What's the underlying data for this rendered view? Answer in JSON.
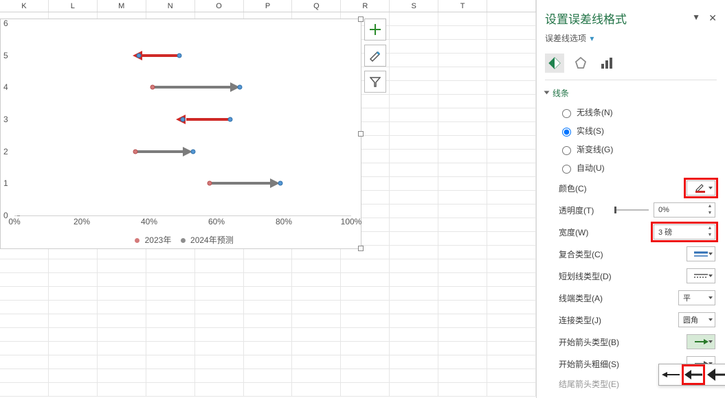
{
  "columns": [
    "K",
    "L",
    "M",
    "N",
    "O",
    "P",
    "Q",
    "R",
    "S",
    "T",
    ""
  ],
  "chart_data": {
    "type": "scatter",
    "title": "",
    "xlabel": "",
    "ylabel": "",
    "ylim": [
      0,
      6
    ],
    "xlim": [
      0,
      1.0
    ],
    "x_ticks": [
      "0%",
      "20%",
      "40%",
      "60%",
      "80%",
      "100%"
    ],
    "y_ticks": [
      "0",
      "1",
      "2",
      "3",
      "4",
      "5",
      "6"
    ],
    "series": [
      {
        "name": "2023年",
        "color": "#d47a7a",
        "points": [
          {
            "x": 0.58,
            "y": 1
          },
          {
            "x": 0.36,
            "y": 2
          },
          {
            "x": 0.64,
            "y": 3
          },
          {
            "x": 0.41,
            "y": 4
          },
          {
            "x": 0.49,
            "y": 5
          }
        ]
      },
      {
        "name": "2024年预测",
        "color": "#8e8e8e",
        "points": [
          {
            "x": 0.79,
            "y": 1
          },
          {
            "x": 0.53,
            "y": 2
          },
          {
            "x": 0.5,
            "y": 3
          },
          {
            "x": 0.67,
            "y": 4
          },
          {
            "x": 0.37,
            "y": 5
          }
        ]
      }
    ],
    "connectors": [
      {
        "y": 1,
        "from": 0.58,
        "to": 0.79,
        "dir": "right",
        "color": "gray"
      },
      {
        "y": 2,
        "from": 0.36,
        "to": 0.53,
        "dir": "right",
        "color": "gray"
      },
      {
        "y": 3,
        "from": 0.64,
        "to": 0.5,
        "dir": "left",
        "color": "red"
      },
      {
        "y": 4,
        "from": 0.41,
        "to": 0.67,
        "dir": "right",
        "color": "gray"
      },
      {
        "y": 5,
        "from": 0.49,
        "to": 0.37,
        "dir": "left",
        "color": "red"
      }
    ],
    "legend": [
      "2023年",
      "2024年预测"
    ]
  },
  "panel": {
    "title": "设置误差线格式",
    "sub": "误差线选项",
    "section": "线条",
    "radios": {
      "none": "无线条(N)",
      "solid": "实线(S)",
      "grad": "渐变线(G)",
      "auto": "自动(U)"
    },
    "fields": {
      "color": "颜色(C)",
      "opacity": "透明度(T)",
      "width": "宽度(W)",
      "compound": "复合类型(C)",
      "dash": "短划线类型(D)",
      "cap": "线端类型(A)",
      "join": "连接类型(J)",
      "beginType": "开始箭头类型(B)",
      "beginSize": "开始箭头粗细(S)",
      "endType": "结尾箭头类型(E)"
    },
    "values": {
      "opacity": "0%",
      "width": "3 磅",
      "cap": "平",
      "join": "圆角"
    }
  }
}
